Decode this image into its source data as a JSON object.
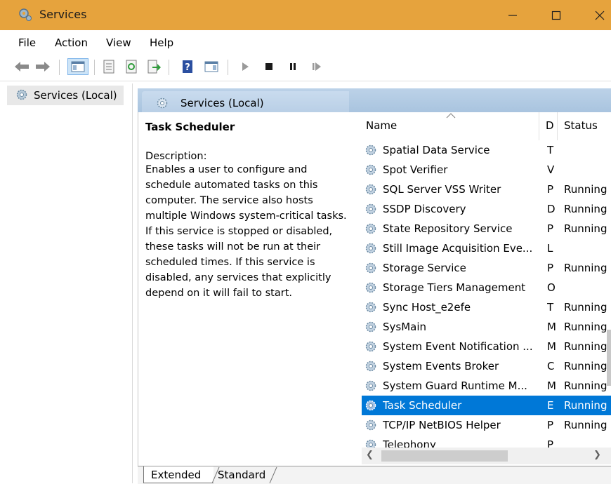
{
  "window": {
    "title": "Services"
  },
  "menu": [
    "File",
    "Action",
    "View",
    "Help"
  ],
  "tree": {
    "root_label": "Services (Local)"
  },
  "main": {
    "header_label": "Services (Local)",
    "selected_service": "Task Scheduler",
    "description_label": "Description:",
    "description_text": "Enables a user to configure and schedule automated tasks on this computer. The service also hosts multiple Windows system-critical tasks. If this service is stopped or disabled, these tasks will not be run at their scheduled times. If this service is disabled, any services that explicitly depend on it will fail to start."
  },
  "list": {
    "columns": [
      "Name",
      "D",
      "Status"
    ],
    "rows": [
      {
        "name": "Spatial Data Service",
        "d": "T",
        "status": ""
      },
      {
        "name": "Spot Verifier",
        "d": "V",
        "status": ""
      },
      {
        "name": "SQL Server VSS Writer",
        "d": "P",
        "status": "Running"
      },
      {
        "name": "SSDP Discovery",
        "d": "D",
        "status": "Running"
      },
      {
        "name": "State Repository Service",
        "d": "P",
        "status": "Running"
      },
      {
        "name": "Still Image Acquisition Eve...",
        "d": "L",
        "status": ""
      },
      {
        "name": "Storage Service",
        "d": "P",
        "status": "Running"
      },
      {
        "name": "Storage Tiers Management",
        "d": "O",
        "status": ""
      },
      {
        "name": "Sync Host_e2efe",
        "d": "T",
        "status": "Running"
      },
      {
        "name": "SysMain",
        "d": "M",
        "status": "Running"
      },
      {
        "name": "System Event Notification ...",
        "d": "M",
        "status": "Running"
      },
      {
        "name": "System Events Broker",
        "d": "C",
        "status": "Running"
      },
      {
        "name": "System Guard Runtime M...",
        "d": "M",
        "status": "Running"
      },
      {
        "name": "Task Scheduler",
        "d": "E",
        "status": "Running",
        "selected": true
      },
      {
        "name": "TCP/IP NetBIOS Helper",
        "d": "P",
        "status": "Running"
      },
      {
        "name": "Telephony",
        "d": "P",
        "status": ""
      }
    ]
  },
  "tabs": {
    "extended": "Extended",
    "standard": "Standard"
  },
  "colors": {
    "titlebar": "#e6a33d",
    "selection": "#0078d7",
    "header": "#b5cce4"
  }
}
